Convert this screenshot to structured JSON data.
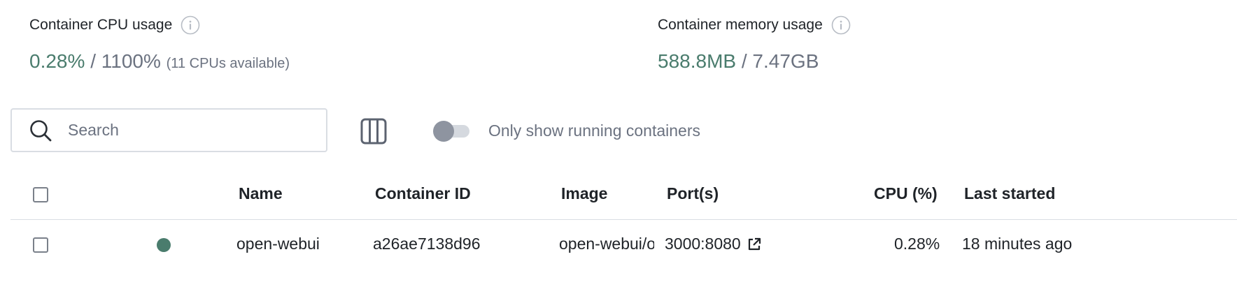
{
  "stats": {
    "cpu": {
      "title": "Container CPU usage",
      "used": "0.28%",
      "separator": "/",
      "total": "1100%",
      "note": "(11 CPUs available)"
    },
    "memory": {
      "title": "Container memory usage",
      "used": "588.8MB",
      "separator": "/",
      "total": "7.47GB"
    }
  },
  "toolbar": {
    "search_placeholder": "Search",
    "search_value": "",
    "toggle_label": "Only show running containers",
    "toggle_on": false
  },
  "table": {
    "columns": {
      "name": "Name",
      "container_id": "Container ID",
      "image": "Image",
      "ports": "Port(s)",
      "cpu": "CPU (%)",
      "last_started": "Last started"
    },
    "rows": [
      {
        "status": "running",
        "name": "open-webui",
        "container_id": "a26ae7138d96",
        "image": "open-webui/open-webui",
        "ports": "3000:8080",
        "cpu": "0.28%",
        "last_started": "18 minutes ago"
      }
    ]
  },
  "colors": {
    "accent": "#4a7c6d",
    "muted": "#6b7280",
    "border": "#d9dde3"
  },
  "icons": {
    "info": "info-circle-icon",
    "search": "magnifier-icon",
    "columns": "columns-icon",
    "external": "external-link-icon"
  }
}
